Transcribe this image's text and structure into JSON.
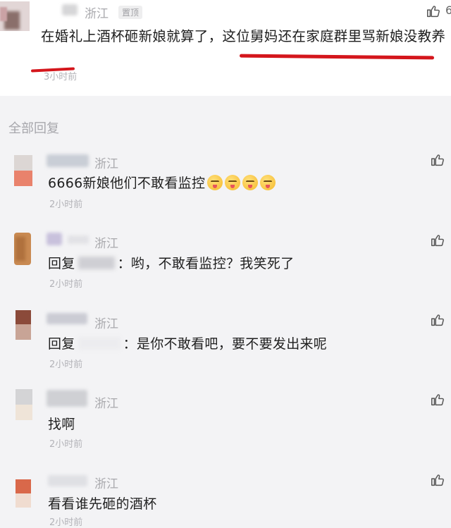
{
  "main_comment": {
    "region": "浙江",
    "pinned_tag": "置顶",
    "text": "在婚礼上酒杯砸新娘就算了，这位舅妈还在家庭群里骂新娘没教养",
    "time": "3小时前",
    "like_count": "6"
  },
  "section_label": "全部回复",
  "replies": [
    {
      "region": "浙江",
      "text": "6666新娘他们不敢看监控",
      "time": "2小时前",
      "emoji": "tongue-out-emoji"
    },
    {
      "region": "浙江",
      "prefix": "回复",
      "text": "：哟，不敢看监控？我笑死了",
      "time": "2小时前"
    },
    {
      "region": "浙江",
      "prefix": "回复",
      "text": "：是你不敢看吧，要不要发出来呢",
      "time": "2小时前"
    },
    {
      "region": "浙江",
      "text": "找啊",
      "time": "2小时前"
    },
    {
      "region": "浙江",
      "text": "看看谁先砸的酒杯",
      "time": "2小时前"
    }
  ],
  "colors": {
    "underline": "#d4161c",
    "background": "#f3f3f5",
    "main_background": "#ffffff"
  }
}
